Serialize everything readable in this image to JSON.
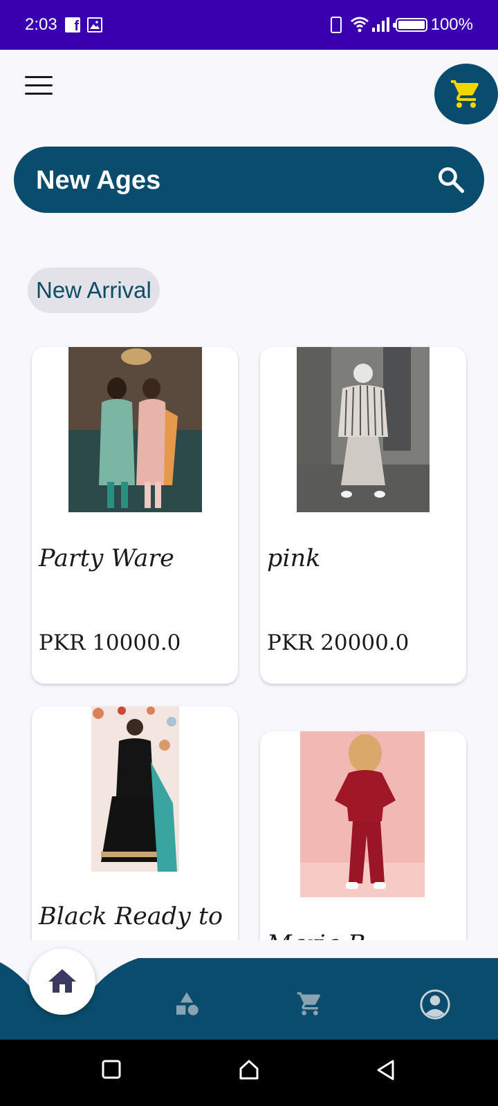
{
  "status_bar": {
    "time": "2:03",
    "battery": "100%",
    "notification_icons": [
      "facebook-icon",
      "image-icon"
    ],
    "system_icons": [
      "phone-icon",
      "wifi-icon",
      "signal-icon",
      "battery-icon"
    ]
  },
  "header": {
    "menu_icon": "hamburger-menu-icon",
    "cart_icon": "cart-icon",
    "cart_fab_color": "#0a4c6d",
    "cart_icon_color": "#f2d600"
  },
  "search": {
    "title": "New Ages",
    "icon": "search-icon",
    "background": "#0a4c6d"
  },
  "section": {
    "chip_label": "New Arrival"
  },
  "products": [
    {
      "name": "Party Ware",
      "price": "PKR 10000.0"
    },
    {
      "name": "pink",
      "price": "PKR 20000.0"
    },
    {
      "name": "Black Ready to"
    },
    {
      "name": "Maria B"
    }
  ],
  "bottom_nav": {
    "items": [
      "home-icon",
      "categories-icon",
      "cart-icon",
      "profile-icon"
    ],
    "background": "#0a4c6d",
    "active": "home-icon"
  },
  "system_nav": [
    "recents-icon",
    "home-icon",
    "back-icon"
  ]
}
